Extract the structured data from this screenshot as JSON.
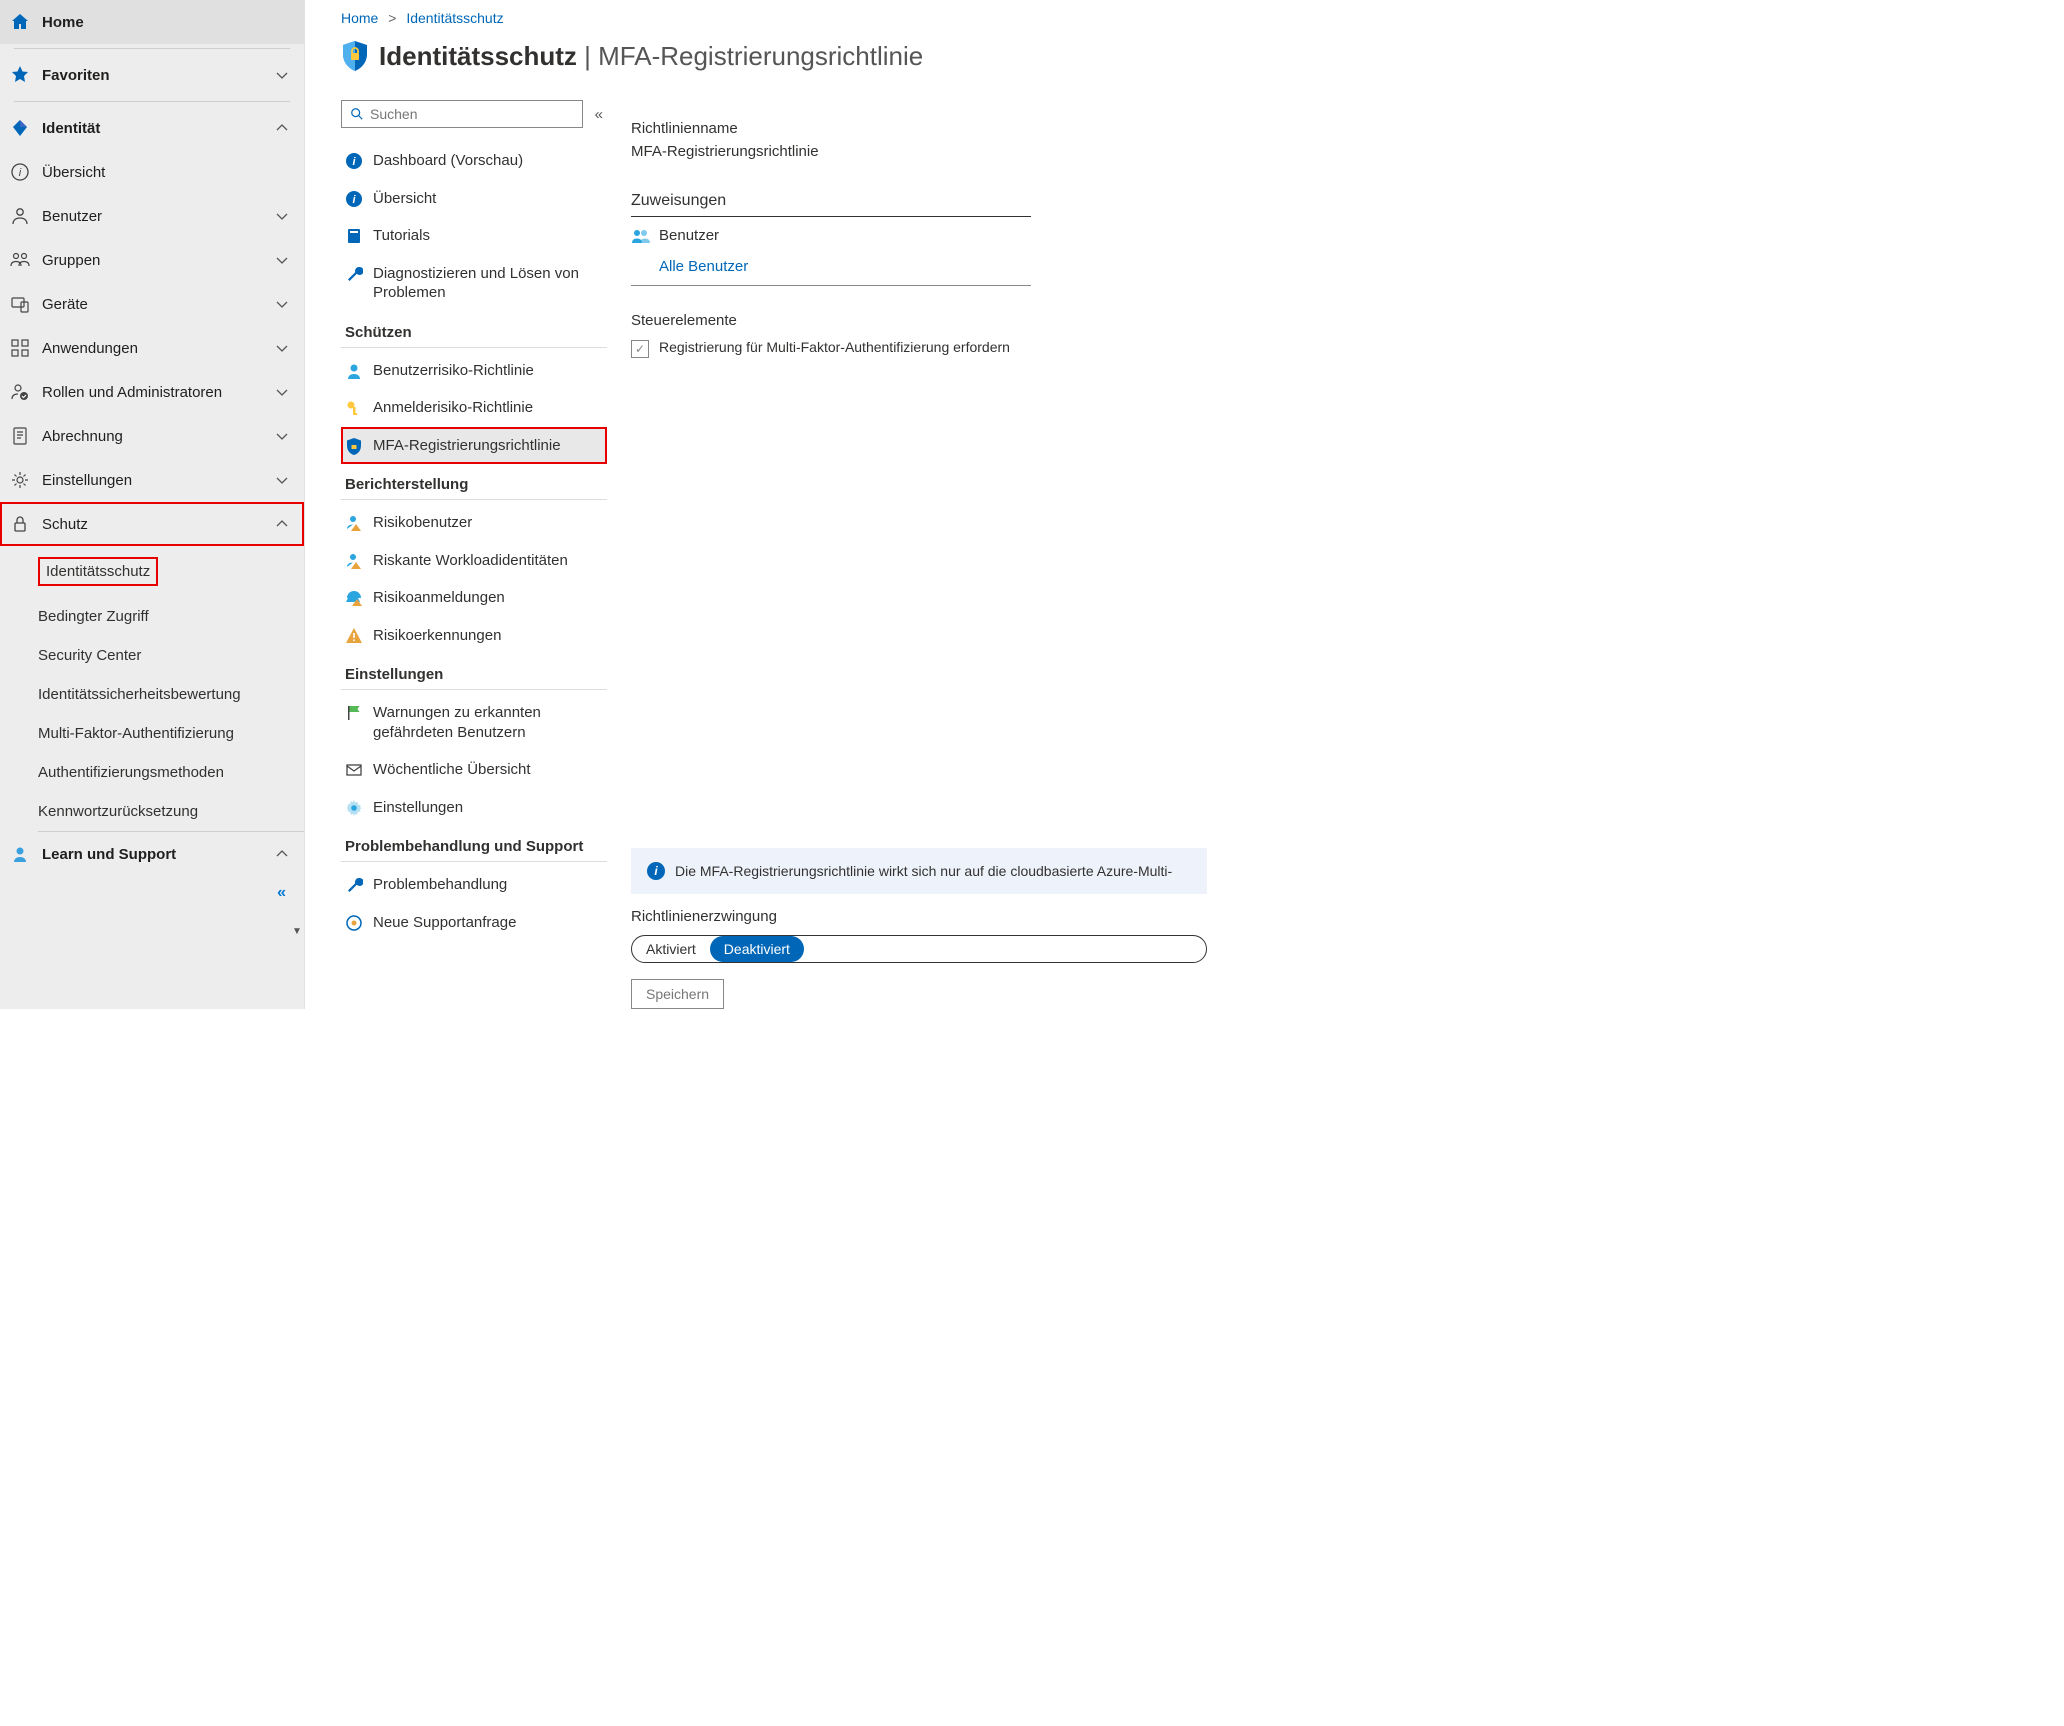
{
  "breadcrumb": {
    "item0": "Home",
    "item1": "Identitätsschutz"
  },
  "pageTitle": {
    "main": "Identitätsschutz",
    "sep": " | ",
    "sub": "MFA-Registrierungsrichtlinie"
  },
  "sidebar": {
    "home": "Home",
    "favoriten": "Favoriten",
    "identitaet": "Identität",
    "uebersicht": "Übersicht",
    "benutzer": "Benutzer",
    "gruppen": "Gruppen",
    "geraete": "Geräte",
    "anwendungen": "Anwendungen",
    "rollen": "Rollen und Administratoren",
    "abrechnung": "Abrechnung",
    "einstellungen": "Einstellungen",
    "schutz": "Schutz",
    "schutz_items": {
      "identitaetsschutz": "Identitätsschutz",
      "bedingter": "Bedingter Zugriff",
      "security_center": "Security Center",
      "bewertung": "Identitätssicherheitsbewertung",
      "mfa": "Multi-Faktor-Authentifizierung",
      "auth_methoden": "Authentifizierungsmethoden",
      "kennwort": "Kennwortzurücksetzung"
    },
    "learn": "Learn und Support",
    "collapse": "«"
  },
  "searchPlaceholder": "Suchen",
  "collapseSecondary": "«",
  "secNav": {
    "dashboard": "Dashboard (Vorschau)",
    "uebersicht": "Übersicht",
    "tutorials": "Tutorials",
    "diagnose": "Diagnostizieren und Lösen von Problemen",
    "group_schuetzen": "Schützen",
    "benutzerrisiko": "Benutzerrisiko-Richtlinie",
    "anmelderisiko": "Anmelderisiko-Richtlinie",
    "mfa_reg": "MFA-Registrierungsrichtlinie",
    "group_bericht": "Berichterstellung",
    "risikobenutzer": "Risikobenutzer",
    "riskante_workload": "Riskante Workloadidentitäten",
    "risikoanmeldungen": "Risikoanmeldungen",
    "risikoerkennungen": "Risikoerkennungen",
    "group_einstellungen": "Einstellungen",
    "warnungen": "Warnungen zu erkannten gefährdeten Benutzern",
    "woechentlich": "Wöchentliche Übersicht",
    "einstellungen": "Einstellungen",
    "group_problembehandlung": "Problembehandlung und Support",
    "problembehandlung": "Problembehandlung",
    "neue_support": "Neue Supportanfrage"
  },
  "main": {
    "richtlinienname_label": "Richtlinienname",
    "richtlinienname_value": "MFA-Registrierungsrichtlinie",
    "zuweisungen": "Zuweisungen",
    "benutzer": "Benutzer",
    "alle_benutzer": "Alle Benutzer",
    "steuerelemente": "Steuerelemente",
    "check_text": "Registrierung für Multi-Faktor-Authentifizierung erfordern",
    "check_mark": "✓",
    "info_text": "Die MFA-Registrierungsrichtlinie wirkt sich nur auf die cloudbasierte Azure-Multi-",
    "erzwingung_label": "Richtlinienerzwingung",
    "toggle_on": "Aktiviert",
    "toggle_off": "Deaktiviert",
    "speichern": "Speichern"
  }
}
